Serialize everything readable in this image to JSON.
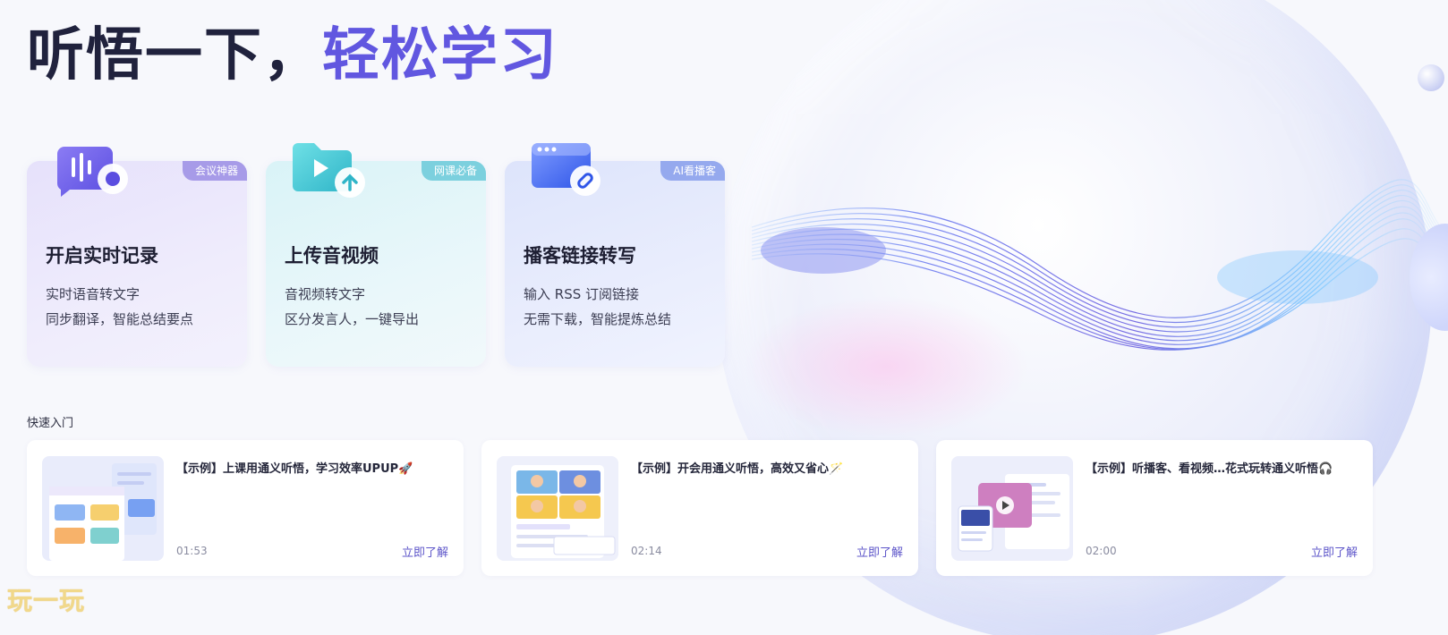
{
  "hero": {
    "title_dark": "听悟一下，",
    "title_accent": "轻松学习"
  },
  "colors": {
    "accent": "#6157e0",
    "dark": "#20223d",
    "link": "#5d55c9"
  },
  "features": [
    {
      "tag": "会议神器",
      "title": "开启实时记录",
      "line1": "实时语音转文字",
      "line2": "同步翻译，智能总结要点",
      "icon": "voice-record-icon"
    },
    {
      "tag": "网课必备",
      "title": "上传音视频",
      "line1": "音视频转文字",
      "line2": "区分发言人，一键导出",
      "icon": "upload-folder-icon"
    },
    {
      "tag": "AI看播客",
      "title": "播客链接转写",
      "line1": "输入 RSS 订阅链接",
      "line2": "无需下载，智能提炼总结",
      "icon": "link-window-icon"
    }
  ],
  "quick_start": {
    "title": "快速入门",
    "items": [
      {
        "title": "【示例】上课用通义听悟，学习效率UPUP🚀",
        "duration": "01:53",
        "link": "立即了解"
      },
      {
        "title": "【示例】开会用通义听悟，高效又省心🪄",
        "duration": "02:14",
        "link": "立即了解"
      },
      {
        "title": "【示例】听播客、看视频…花式玩转通义听悟🎧",
        "duration": "02:00",
        "link": "立即了解"
      }
    ]
  },
  "watermark": "玩一玩"
}
